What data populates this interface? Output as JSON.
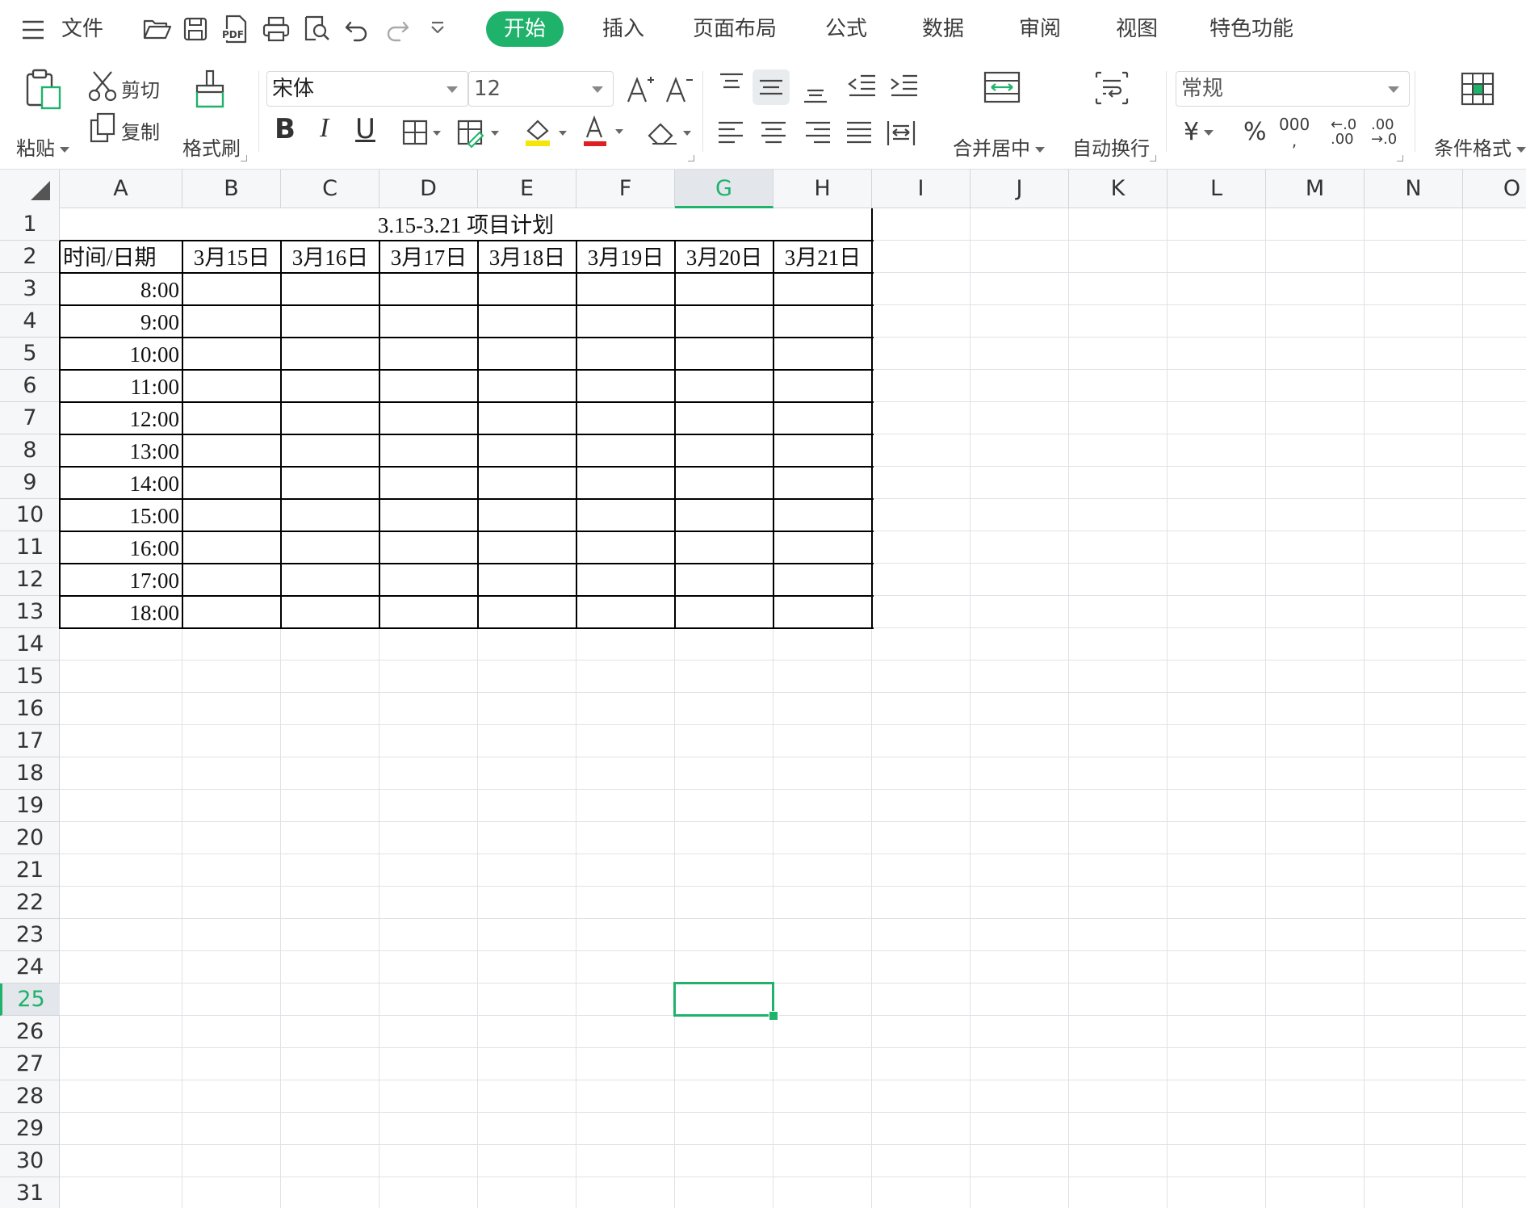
{
  "menubar": {
    "file_label": "文件",
    "tabs": [
      {
        "label": "开始",
        "active": true
      },
      {
        "label": "插入"
      },
      {
        "label": "页面布局"
      },
      {
        "label": "公式"
      },
      {
        "label": "数据"
      },
      {
        "label": "审阅"
      },
      {
        "label": "视图"
      },
      {
        "label": "特色功能"
      }
    ],
    "quick_access_icons": [
      "open-folder-icon",
      "save-icon",
      "pdf-export-icon",
      "print-icon",
      "print-preview-icon",
      "undo-icon",
      "redo-icon",
      "customize-dropdown-icon"
    ],
    "pdf_text": "PDF"
  },
  "ribbon": {
    "paste_label": "粘贴",
    "cut_label": "剪切",
    "copy_label": "复制",
    "format_painter_label": "格式刷",
    "font_name": "宋体",
    "font_size": "12",
    "bold": "B",
    "italic": "I",
    "underline": "U",
    "merge_center_label": "合并居中",
    "wrap_text_label": "自动换行",
    "number_format": "常规",
    "currency_symbol": "¥",
    "percent_symbol": "%",
    "thousands_symbol": "000",
    "increase_decimal": "←.0\n.00",
    "decrease_decimal": ".00\n→.0",
    "conditional_format_label": "条件格式",
    "font_color": "#e02020",
    "fill_color": "#f5e50a"
  },
  "sheet": {
    "columns": [
      "A",
      "B",
      "C",
      "D",
      "E",
      "F",
      "G",
      "H",
      "I",
      "J",
      "K",
      "L",
      "M",
      "N",
      "O"
    ],
    "selected_column": "G",
    "rows": [
      "1",
      "2",
      "3",
      "4",
      "5",
      "6",
      "7",
      "8",
      "9",
      "10",
      "11",
      "12",
      "13",
      "14",
      "15",
      "16",
      "17",
      "18",
      "19",
      "20",
      "21",
      "22",
      "23",
      "24",
      "25",
      "26",
      "27",
      "28",
      "29",
      "30",
      "31"
    ],
    "selected_row": "25",
    "title": "3.15-3.21 项目计划",
    "header_first": "时间/日期",
    "dates": [
      "3月15日",
      "3月16日",
      "3月17日",
      "3月18日",
      "3月19日",
      "3月20日",
      "3月21日"
    ],
    "times": [
      "8:00",
      "9:00",
      "10:00",
      "11:00",
      "12:00",
      "13:00",
      "14:00",
      "15:00",
      "16:00",
      "17:00",
      "18:00"
    ],
    "accent_color": "#1eb26b"
  }
}
